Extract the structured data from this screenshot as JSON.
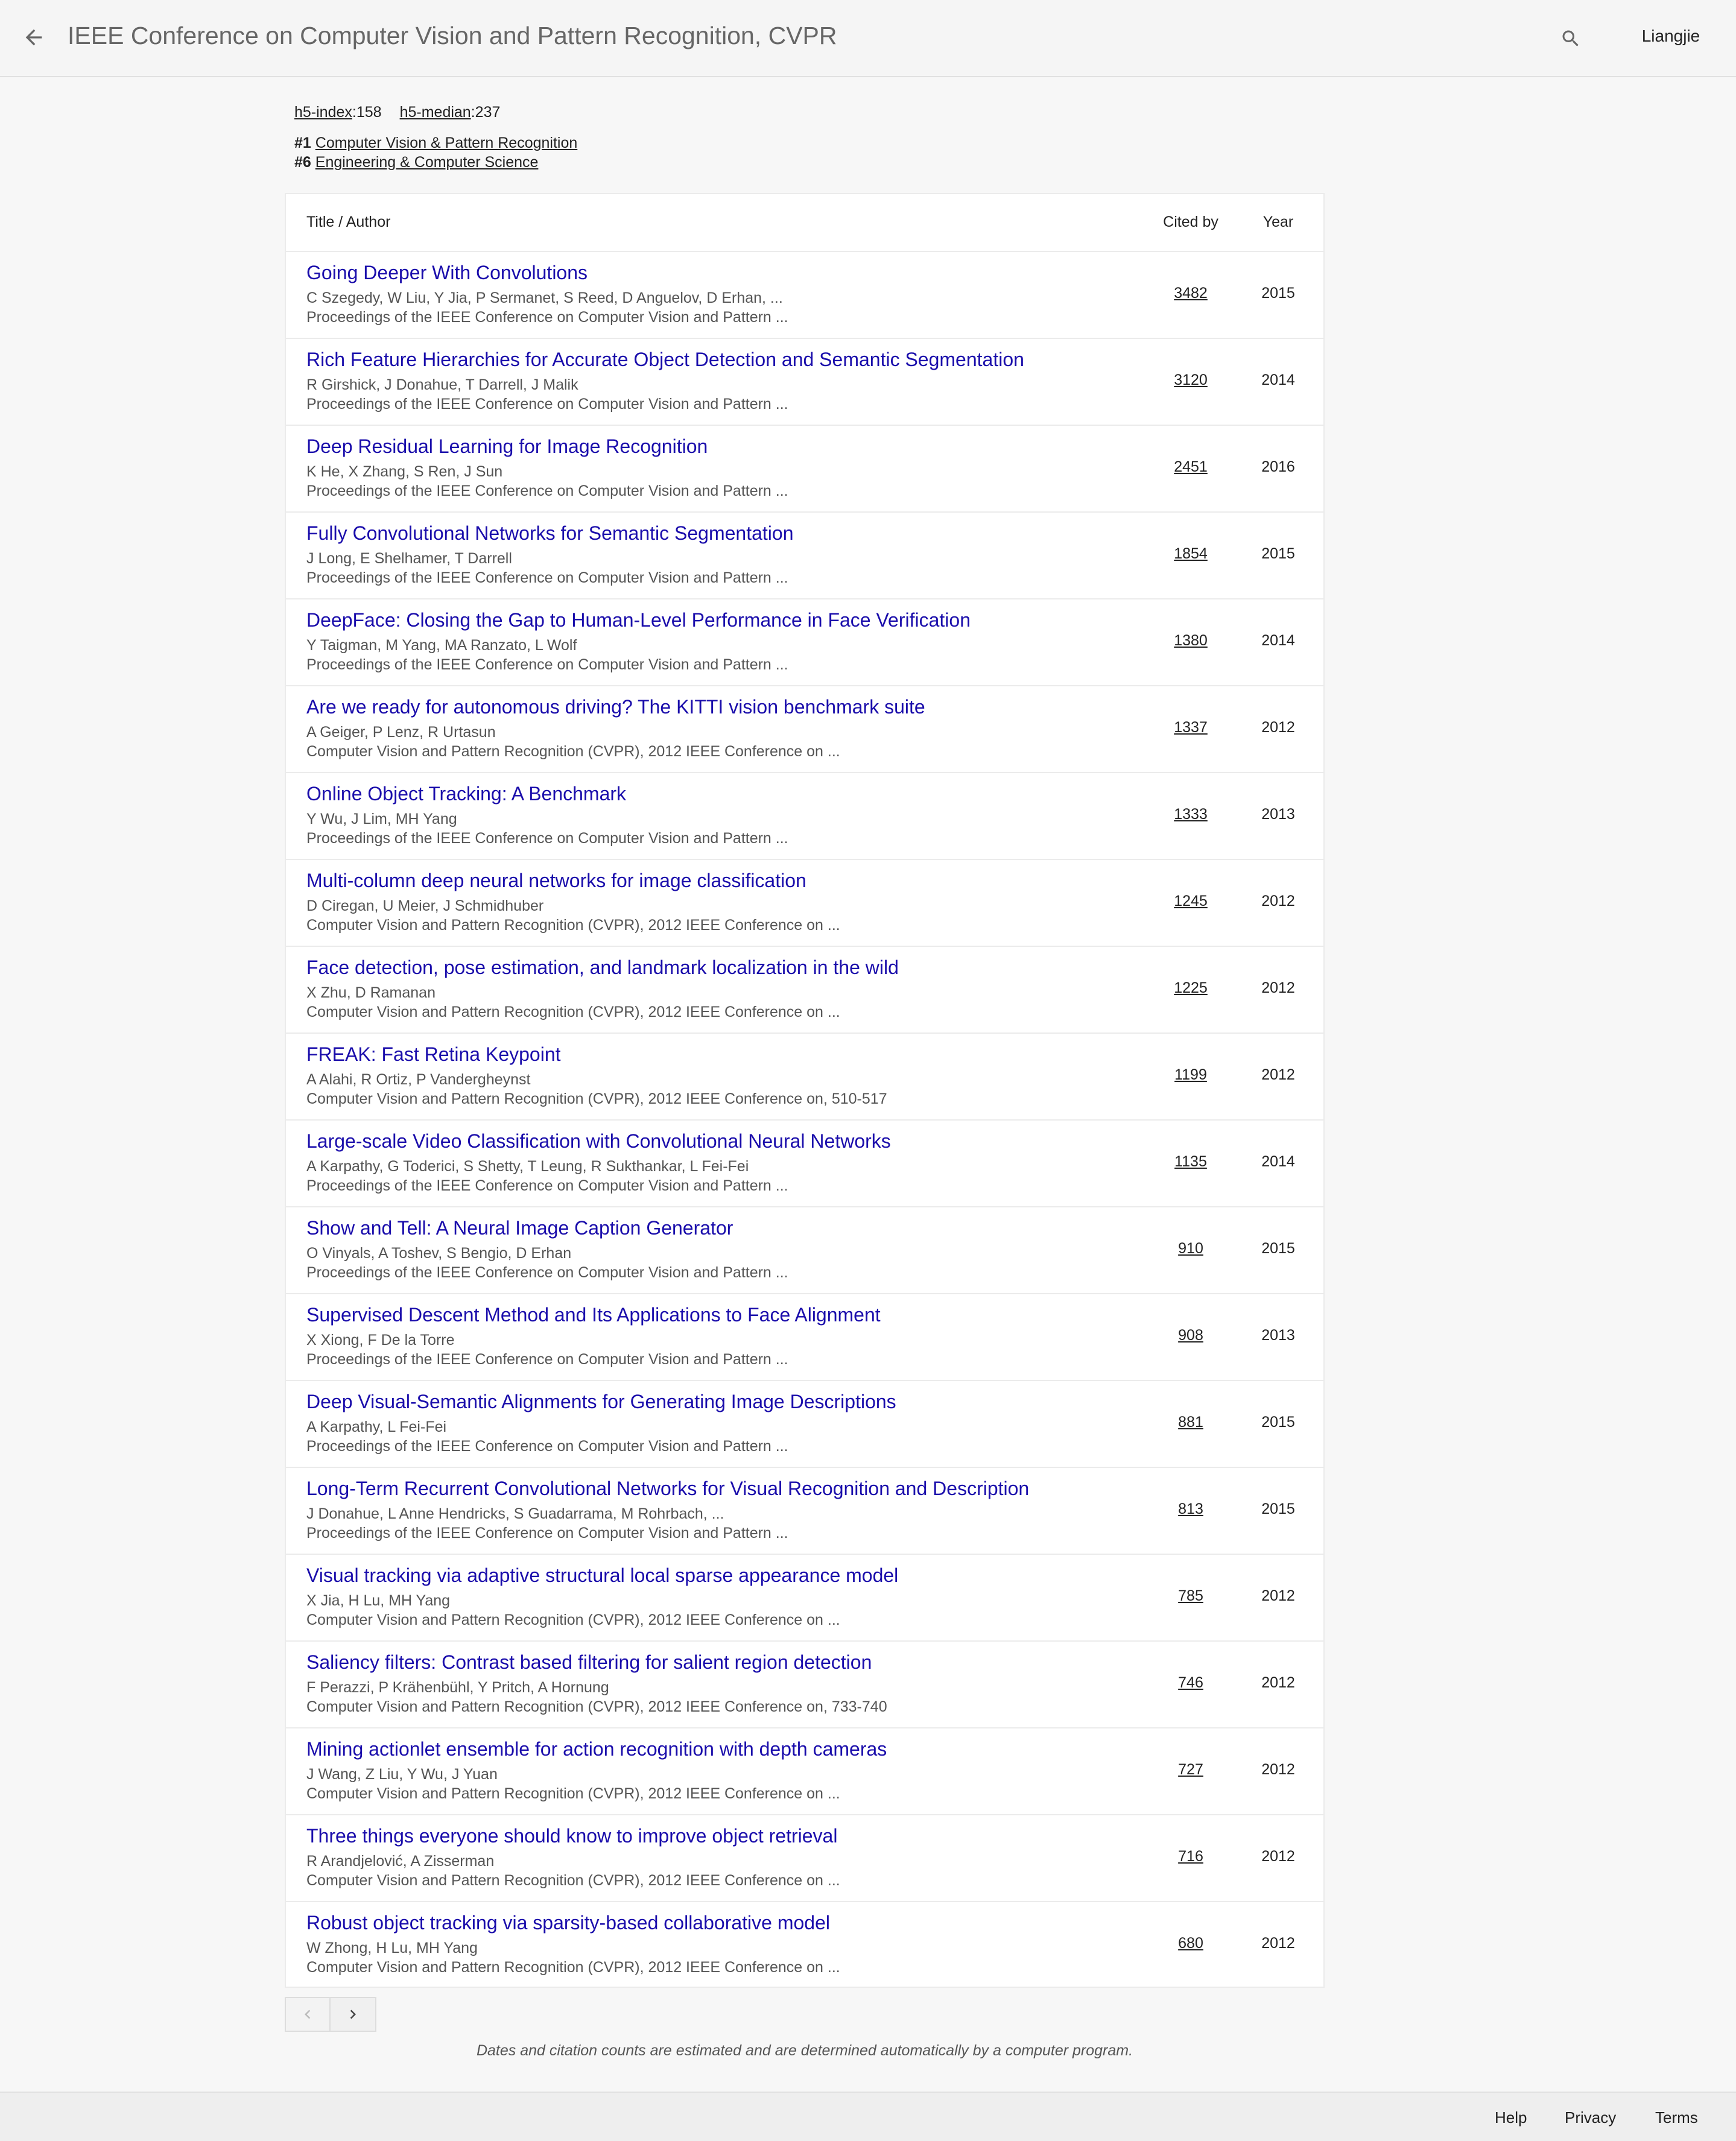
{
  "header": {
    "title": "IEEE Conference on Computer Vision and Pattern Recognition, CVPR",
    "user": "Liangjie",
    "back_icon": "arrow-left-icon",
    "search_icon": "search-icon"
  },
  "metrics": {
    "h5_index_label": "h5-index",
    "h5_index_value": ":158",
    "h5_median_label": "h5-median",
    "h5_median_value": ":237"
  },
  "rankings": [
    {
      "rank": "#1",
      "category": "Computer Vision & Pattern Recognition"
    },
    {
      "rank": "#6",
      "category": "Engineering & Computer Science"
    }
  ],
  "table": {
    "headers": {
      "title": "Title / Author",
      "cited": "Cited by",
      "year": "Year"
    },
    "rows": [
      {
        "title": "Going Deeper With Convolutions",
        "authors": "C Szegedy, W Liu, Y Jia, P Sermanet, S Reed, D Anguelov, D Erhan, ...",
        "venue": "Proceedings of the IEEE Conference on Computer Vision and Pattern ...",
        "cited": "3482",
        "year": "2015"
      },
      {
        "title": "Rich Feature Hierarchies for Accurate Object Detection and Semantic Segmentation",
        "authors": "R Girshick, J Donahue, T Darrell, J Malik",
        "venue": "Proceedings of the IEEE Conference on Computer Vision and Pattern ...",
        "cited": "3120",
        "year": "2014"
      },
      {
        "title": "Deep Residual Learning for Image Recognition",
        "authors": "K He, X Zhang, S Ren, J Sun",
        "venue": "Proceedings of the IEEE Conference on Computer Vision and Pattern ...",
        "cited": "2451",
        "year": "2016"
      },
      {
        "title": "Fully Convolutional Networks for Semantic Segmentation",
        "authors": "J Long, E Shelhamer, T Darrell",
        "venue": "Proceedings of the IEEE Conference on Computer Vision and Pattern ...",
        "cited": "1854",
        "year": "2015"
      },
      {
        "title": "DeepFace: Closing the Gap to Human-Level Performance in Face Verification",
        "authors": "Y Taigman, M Yang, MA Ranzato, L Wolf",
        "venue": "Proceedings of the IEEE Conference on Computer Vision and Pattern ...",
        "cited": "1380",
        "year": "2014"
      },
      {
        "title": "Are we ready for autonomous driving? The KITTI vision benchmark suite",
        "authors": "A Geiger, P Lenz, R Urtasun",
        "venue": "Computer Vision and Pattern Recognition (CVPR), 2012 IEEE Conference on ...",
        "cited": "1337",
        "year": "2012"
      },
      {
        "title": "Online Object Tracking: A Benchmark",
        "authors": "Y Wu, J Lim, MH Yang",
        "venue": "Proceedings of the IEEE Conference on Computer Vision and Pattern ...",
        "cited": "1333",
        "year": "2013"
      },
      {
        "title": "Multi-column deep neural networks for image classification",
        "authors": "D Ciregan, U Meier, J Schmidhuber",
        "venue": "Computer Vision and Pattern Recognition (CVPR), 2012 IEEE Conference on ...",
        "cited": "1245",
        "year": "2012"
      },
      {
        "title": "Face detection, pose estimation, and landmark localization in the wild",
        "authors": "X Zhu, D Ramanan",
        "venue": "Computer Vision and Pattern Recognition (CVPR), 2012 IEEE Conference on ...",
        "cited": "1225",
        "year": "2012"
      },
      {
        "title": "FREAK: Fast Retina Keypoint",
        "authors": "A Alahi, R Ortiz, P Vandergheynst",
        "venue": "Computer Vision and Pattern Recognition (CVPR), 2012 IEEE Conference on, 510-517",
        "cited": "1199",
        "year": "2012"
      },
      {
        "title": "Large-scale Video Classification with Convolutional Neural Networks",
        "authors": "A Karpathy, G Toderici, S Shetty, T Leung, R Sukthankar, L Fei-Fei",
        "venue": "Proceedings of the IEEE Conference on Computer Vision and Pattern ...",
        "cited": "1135",
        "year": "2014"
      },
      {
        "title": "Show and Tell: A Neural Image Caption Generator",
        "authors": "O Vinyals, A Toshev, S Bengio, D Erhan",
        "venue": "Proceedings of the IEEE Conference on Computer Vision and Pattern ...",
        "cited": "910",
        "year": "2015"
      },
      {
        "title": "Supervised Descent Method and Its Applications to Face Alignment",
        "authors": "X Xiong, F De la Torre",
        "venue": "Proceedings of the IEEE Conference on Computer Vision and Pattern ...",
        "cited": "908",
        "year": "2013"
      },
      {
        "title": "Deep Visual-Semantic Alignments for Generating Image Descriptions",
        "authors": "A Karpathy, L Fei-Fei",
        "venue": "Proceedings of the IEEE Conference on Computer Vision and Pattern ...",
        "cited": "881",
        "year": "2015"
      },
      {
        "title": "Long-Term Recurrent Convolutional Networks for Visual Recognition and Description",
        "authors": "J Donahue, L Anne Hendricks, S Guadarrama, M Rohrbach, ...",
        "venue": "Proceedings of the IEEE Conference on Computer Vision and Pattern ...",
        "cited": "813",
        "year": "2015"
      },
      {
        "title": "Visual tracking via adaptive structural local sparse appearance model",
        "authors": "X Jia, H Lu, MH Yang",
        "venue": "Computer Vision and Pattern Recognition (CVPR), 2012 IEEE Conference on ...",
        "cited": "785",
        "year": "2012"
      },
      {
        "title": "Saliency filters: Contrast based filtering for salient region detection",
        "authors": "F Perazzi, P Krähenbühl, Y Pritch, A Hornung",
        "venue": "Computer Vision and Pattern Recognition (CVPR), 2012 IEEE Conference on, 733-740",
        "cited": "746",
        "year": "2012"
      },
      {
        "title": "Mining actionlet ensemble for action recognition with depth cameras",
        "authors": "J Wang, Z Liu, Y Wu, J Yuan",
        "venue": "Computer Vision and Pattern Recognition (CVPR), 2012 IEEE Conference on ...",
        "cited": "727",
        "year": "2012"
      },
      {
        "title": "Three things everyone should know to improve object retrieval",
        "authors": "R Arandjelović, A Zisserman",
        "venue": "Computer Vision and Pattern Recognition (CVPR), 2012 IEEE Conference on ...",
        "cited": "716",
        "year": "2012"
      },
      {
        "title": "Robust object tracking via sparsity-based collaborative model",
        "authors": "W Zhong, H Lu, MH Yang",
        "venue": "Computer Vision and Pattern Recognition (CVPR), 2012 IEEE Conference on ...",
        "cited": "680",
        "year": "2012"
      }
    ]
  },
  "pagination": {
    "prev_icon": "chevron-left-icon",
    "next_icon": "chevron-right-icon"
  },
  "disclaimer": "Dates and citation counts are estimated and are determined automatically by a computer program.",
  "footer": {
    "help": "Help",
    "privacy": "Privacy",
    "terms": "Terms"
  },
  "colors": {
    "title_link": "#1a0dab",
    "background": "#f7f7f7"
  }
}
